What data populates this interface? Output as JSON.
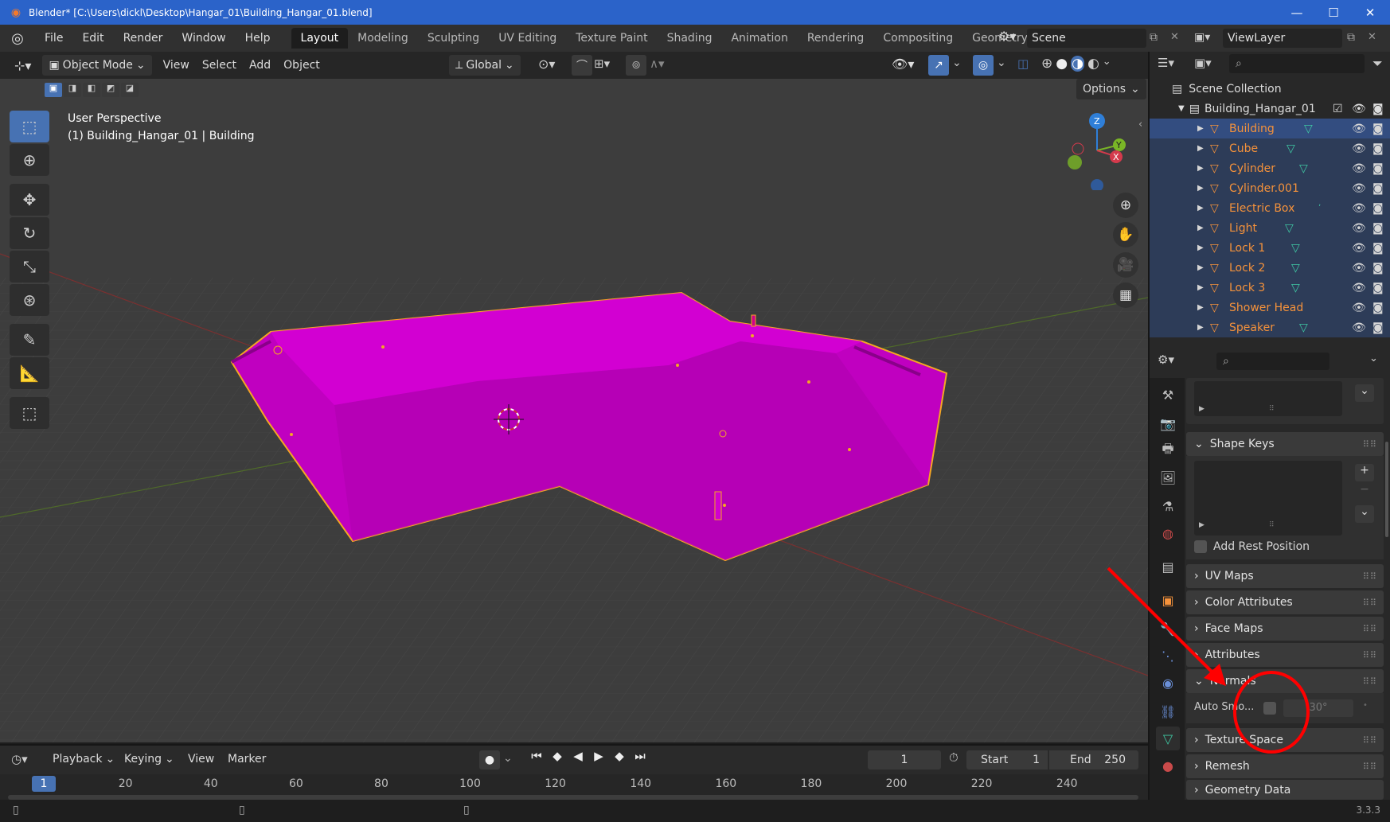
{
  "window": {
    "title": "Blender* [C:\\Users\\dickl\\Desktop\\Hangar_01\\Building_Hangar_01.blend]",
    "controls": [
      "—",
      "☐",
      "✕"
    ]
  },
  "menu": [
    "File",
    "Edit",
    "Render",
    "Window",
    "Help"
  ],
  "workspaces": [
    "Layout",
    "Modeling",
    "Sculpting",
    "UV Editing",
    "Texture Paint",
    "Shading",
    "Animation",
    "Rendering",
    "Compositing",
    "Geometry Nodes"
  ],
  "active_workspace": "Layout",
  "scene": {
    "label": "Scene",
    "view_layer": "ViewLayer"
  },
  "viewport_header": {
    "mode": "Object Mode",
    "menus": [
      "View",
      "Select",
      "Add",
      "Object"
    ],
    "orientation": "Global",
    "options": "Options"
  },
  "viewport": {
    "perspective": "User Perspective",
    "object_info": "(1) Building_Hangar_01 | Building",
    "gizmo": {
      "z": "Z",
      "y": "Y",
      "x": "X"
    },
    "mesh_color": "#cc00cc",
    "outline_color": "#f5a623"
  },
  "outliner": {
    "root": "Scene Collection",
    "collection": "Building_Hangar_01",
    "items": [
      {
        "name": "Building",
        "selected": true
      },
      {
        "name": "Cube",
        "selected": false
      },
      {
        "name": "Cylinder",
        "selected": false
      },
      {
        "name": "Cylinder.001",
        "selected": false
      },
      {
        "name": "Electric Box",
        "selected": false
      },
      {
        "name": "Light",
        "selected": false
      },
      {
        "name": "Lock 1",
        "selected": false
      },
      {
        "name": "Lock 2",
        "selected": false
      },
      {
        "name": "Lock 3",
        "selected": false
      },
      {
        "name": "Shower Head",
        "selected": false
      },
      {
        "name": "Speaker",
        "selected": false
      }
    ]
  },
  "properties": {
    "panels": {
      "shape_keys": "Shape Keys",
      "add_rest_position": "Add Rest Position",
      "uv_maps": "UV Maps",
      "color_attributes": "Color Attributes",
      "face_maps": "Face Maps",
      "attributes": "Attributes",
      "normals": "Normals",
      "auto_smooth": "Auto Smo...",
      "auto_smooth_angle": "30°",
      "texture_space": "Texture Space",
      "remesh": "Remesh",
      "geometry_data": "Geometry Data"
    }
  },
  "timeline": {
    "menus": [
      "Playback",
      "Keying",
      "View",
      "Marker"
    ],
    "current_frame": "1",
    "start_label": "Start",
    "start": "1",
    "end_label": "End",
    "end": "250",
    "ruler": [
      "20",
      "40",
      "60",
      "80",
      "100",
      "120",
      "140",
      "160",
      "180",
      "200",
      "220",
      "240"
    ],
    "playhead": "1"
  },
  "status": {
    "version": "3.3.3"
  },
  "annotation": {
    "color": "#ff0000"
  }
}
